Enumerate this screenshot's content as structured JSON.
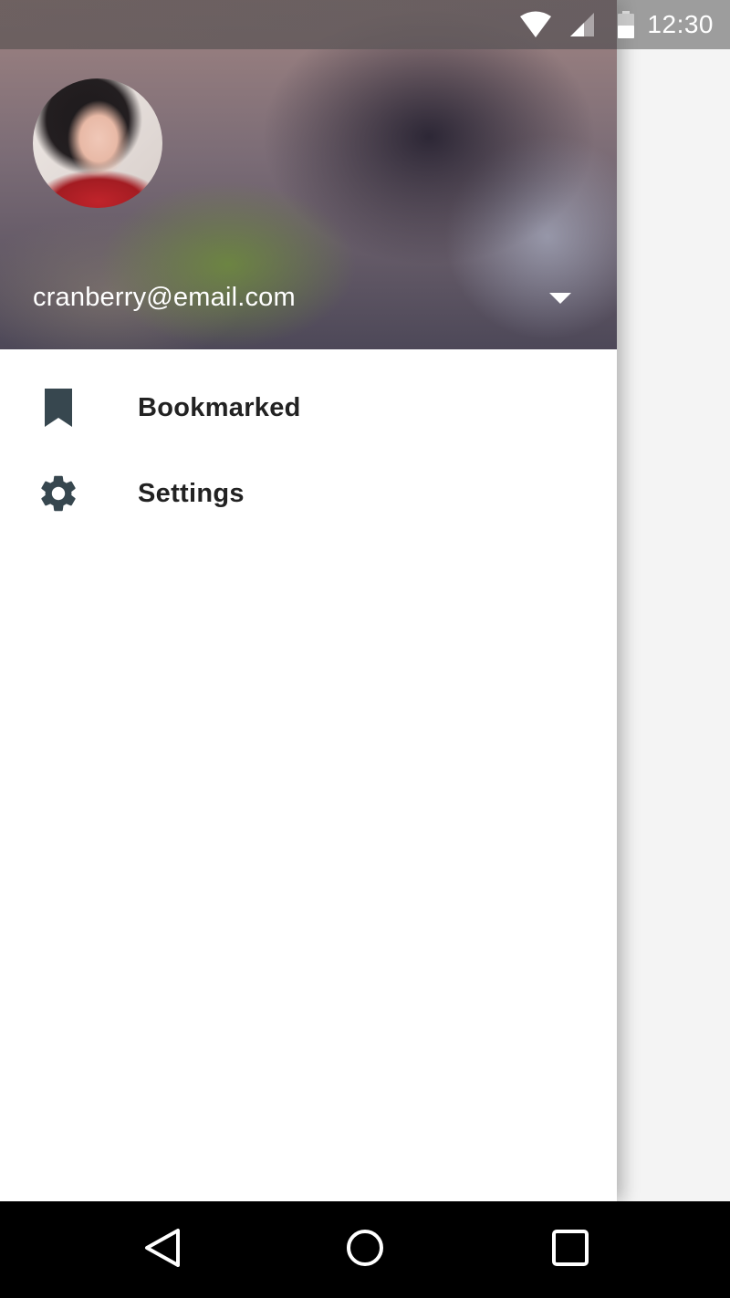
{
  "status_bar": {
    "time": "12:30",
    "icons": [
      "wifi-icon",
      "cell-signal-icon",
      "battery-icon"
    ]
  },
  "drawer": {
    "account": {
      "email": "cranberry@email.com",
      "avatar": "profile-photo",
      "toggle_icon": "dropdown-arrow-icon"
    },
    "items": [
      {
        "label": "Bookmarked",
        "icon": "bookmark-icon"
      },
      {
        "label": "Settings",
        "icon": "gear-icon"
      }
    ],
    "icon_color": "#37474f"
  },
  "nav_bar": {
    "buttons": [
      "back-icon",
      "home-icon",
      "recents-icon"
    ]
  },
  "colors": {
    "drawer_background": "#ffffff",
    "text_primary": "#222222",
    "nav_bar": "#000000"
  }
}
